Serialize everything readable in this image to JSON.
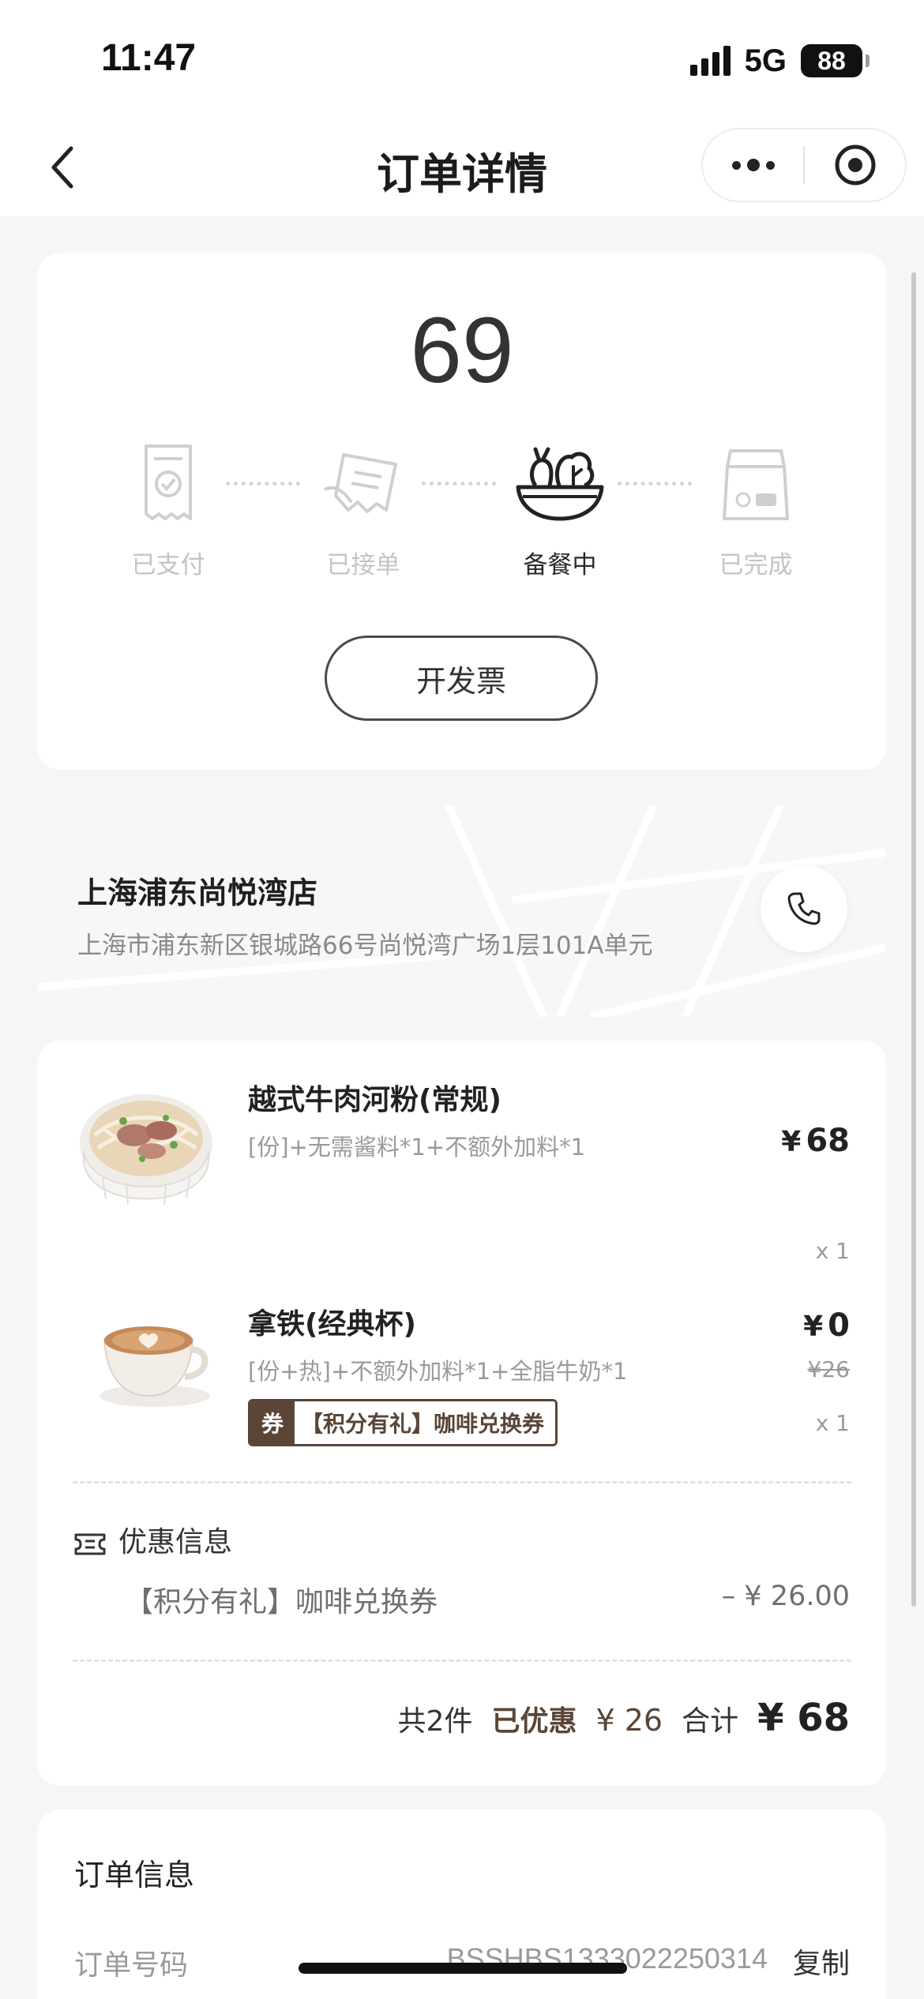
{
  "status_bar": {
    "time": "11:47",
    "network": "5G",
    "battery": "88"
  },
  "nav": {
    "title": "订单详情"
  },
  "order_status": {
    "pickup_number": "69",
    "steps": [
      {
        "label": "已支付",
        "active": false
      },
      {
        "label": "已接单",
        "active": false
      },
      {
        "label": "备餐中",
        "active": true
      },
      {
        "label": "已完成",
        "active": false
      }
    ],
    "invoice_button": "开发票"
  },
  "store": {
    "name": "上海浦东尚悦湾店",
    "address": "上海市浦东新区银城路66号尚悦湾广场1层101A单元"
  },
  "items": [
    {
      "name": "越式牛肉河粉(常规)",
      "spec": "[份]+无需酱料*1+不额外加料*1",
      "currency": "¥",
      "price": "68",
      "qty": "x 1"
    },
    {
      "name": "拿铁(经典杯)",
      "spec": "[份+热]+不额外加料*1+全脂牛奶*1",
      "currency": "¥",
      "price": "0",
      "original_price": "¥26",
      "qty": "x 1",
      "coupon_tag_label": "券",
      "coupon_tag_text": "【积分有礼】咖啡兑换券"
    }
  ],
  "discount": {
    "title": "优惠信息",
    "name": "【积分有礼】咖啡兑换券",
    "amount": "– ¥ 26.00"
  },
  "summary": {
    "count": "共2件",
    "saved_label": "已优惠",
    "saved_value": "¥ 26",
    "total_label": "合计",
    "total_value": "¥ 68"
  },
  "order_info": {
    "title": "订单信息",
    "order_no_label": "订单号码",
    "order_no_value": "BSSHBS1333022250314",
    "copy_label": "复制"
  },
  "colors": {
    "accent_brown": "#5a4537",
    "muted": "#c4c4c4"
  }
}
